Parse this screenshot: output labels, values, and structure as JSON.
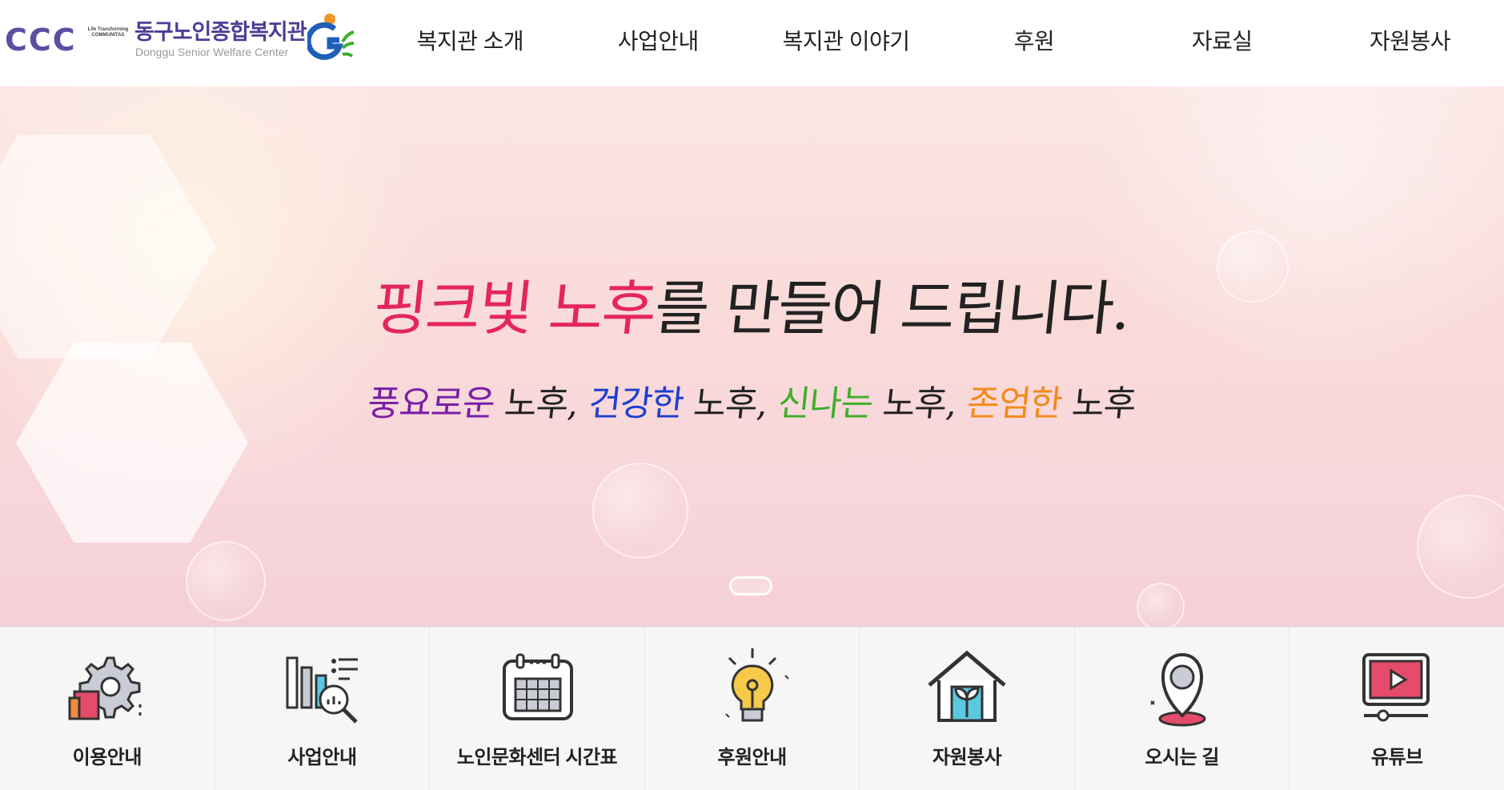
{
  "logo": {
    "mark": "CCC",
    "communitas": "Life Transforming COMMUNITAS",
    "name_ko": "동구노인종합복지관",
    "name_en": "Donggu Senior Welfare Center"
  },
  "nav": {
    "items": [
      {
        "label": "복지관 소개"
      },
      {
        "label": "사업안내"
      },
      {
        "label": "복지관 이야기"
      },
      {
        "label": "후원"
      },
      {
        "label": "자료실"
      },
      {
        "label": "자원봉사"
      }
    ]
  },
  "hero": {
    "headline_pink": "핑크빛 노후",
    "headline_rest": "를 만들어 드립니다.",
    "sub_1": "풍요로운",
    "sub_2": " 노후, ",
    "sub_3": "건강한",
    "sub_4": " 노후, ",
    "sub_5": "신나는",
    "sub_6": " 노후, ",
    "sub_7": "존엄한",
    "sub_8": " 노후"
  },
  "quick_menu": {
    "items": [
      {
        "label": "이용안내",
        "icon": "gear-document-icon"
      },
      {
        "label": "사업안내",
        "icon": "chart-search-icon"
      },
      {
        "label": "노인문화센터 시간표",
        "icon": "calendar-icon"
      },
      {
        "label": "후원안내",
        "icon": "lightbulb-icon"
      },
      {
        "label": "자원봉사",
        "icon": "house-plant-icon"
      },
      {
        "label": "오시는 길",
        "icon": "map-pin-icon"
      },
      {
        "label": "유튜브",
        "icon": "video-player-icon"
      }
    ]
  },
  "colors": {
    "brand_purple": "#4a3f95",
    "headline_pink": "#e4265a",
    "sub_purple": "#7a1fa8",
    "sub_blue": "#1d3fd0",
    "sub_green": "#3fae2a",
    "sub_orange": "#f28a1a",
    "icon_orange": "#f08a3c",
    "icon_blue": "#5cc8e0",
    "icon_pink": "#e54b6a"
  }
}
